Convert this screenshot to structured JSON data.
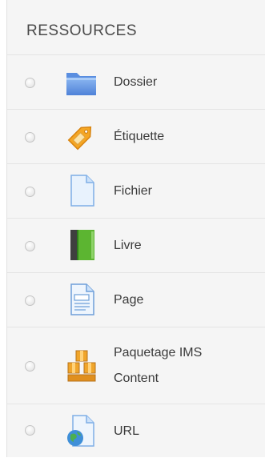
{
  "section": {
    "title": "RESSOURCES"
  },
  "items": [
    {
      "label": "Dossier",
      "icon": "folder-icon"
    },
    {
      "label": "Étiquette",
      "icon": "tag-icon"
    },
    {
      "label": "Fichier",
      "icon": "file-icon"
    },
    {
      "label": "Livre",
      "icon": "book-icon"
    },
    {
      "label": "Page",
      "icon": "page-icon"
    },
    {
      "label": "Paquetage IMS\nContent",
      "icon": "ims-package-icon"
    },
    {
      "label": "URL",
      "icon": "url-globe-icon"
    }
  ],
  "colors": {
    "panel_background": "#f5f5f5",
    "folder_blue": "#6f9fe6",
    "tag_orange": "#f3a32b",
    "book_green": "#5cb531",
    "text": "#3a3a3a"
  }
}
